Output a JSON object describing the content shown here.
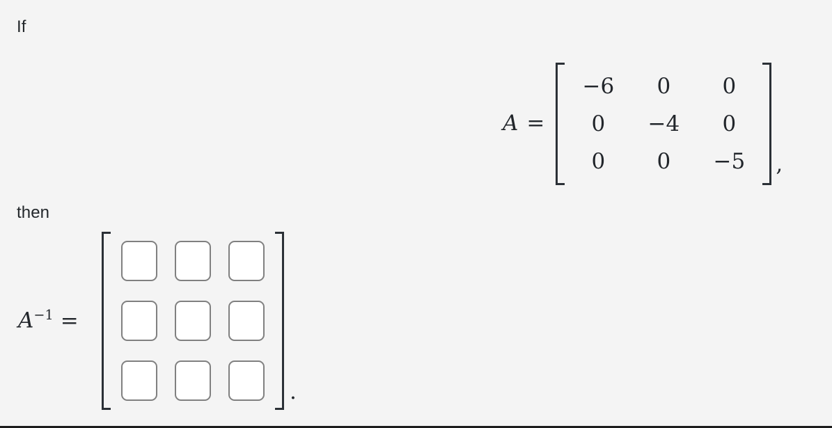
{
  "page": {
    "background_color": "#f4f4f4",
    "text_color": "#23272b",
    "bracket_color": "#2b3036",
    "input_border_color": "#808080",
    "input_fill_color": "#ffffff"
  },
  "prose": {
    "if": "If",
    "then": "then"
  },
  "equation_a": {
    "lhs_variable": "A",
    "equals": "=",
    "trailing_punctuation": ",",
    "matrix": {
      "rows": 3,
      "cols": 3,
      "values": [
        [
          "−6",
          "0",
          "0"
        ],
        [
          "0",
          "−4",
          "0"
        ],
        [
          "0",
          "0",
          "−5"
        ]
      ]
    }
  },
  "equation_a_inverse": {
    "lhs_variable": "A",
    "lhs_exponent": "−1",
    "equals": "=",
    "trailing_punctuation": ".",
    "matrix": {
      "rows": 3,
      "cols": 3,
      "values": [
        [
          "",
          "",
          ""
        ],
        [
          "",
          "",
          ""
        ],
        [
          "",
          "",
          ""
        ]
      ],
      "placeholders": [
        [
          "",
          "",
          ""
        ],
        [
          "",
          "",
          ""
        ],
        [
          "",
          "",
          ""
        ]
      ]
    }
  }
}
